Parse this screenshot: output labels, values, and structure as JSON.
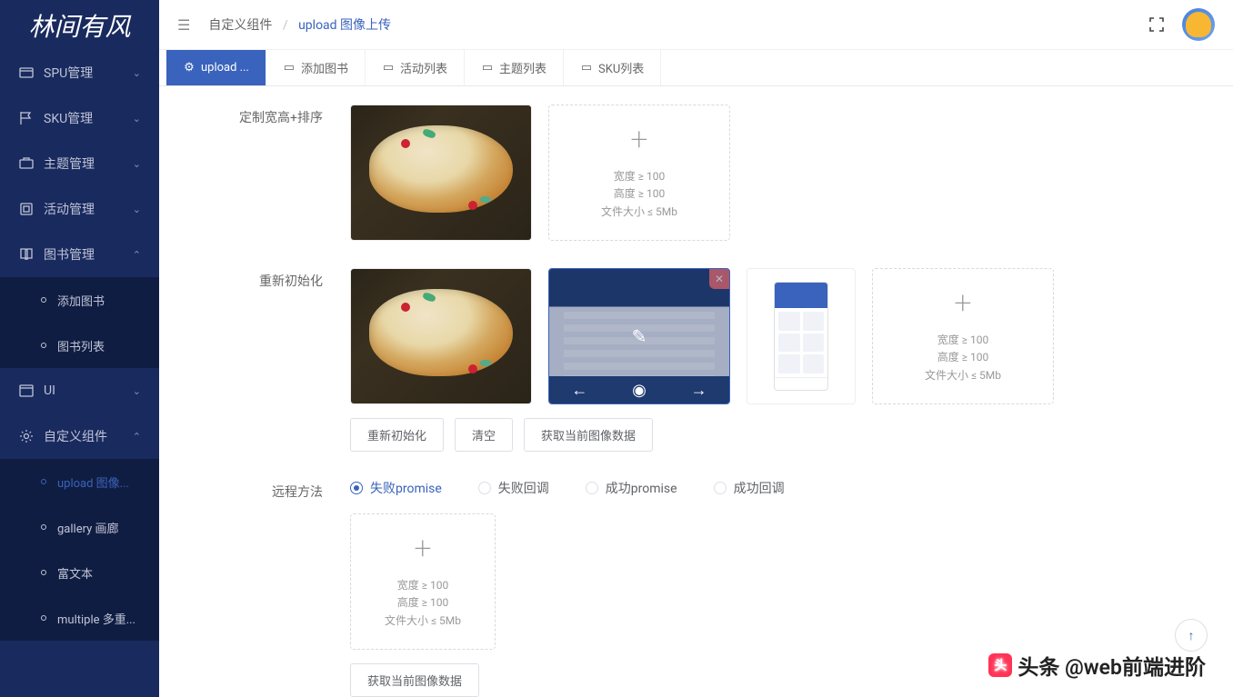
{
  "logo": "林间有风",
  "sidebar": {
    "items": [
      {
        "label": "SPU管理",
        "expanded": false
      },
      {
        "label": "SKU管理",
        "expanded": false
      },
      {
        "label": "主题管理",
        "expanded": false
      },
      {
        "label": "活动管理",
        "expanded": false
      },
      {
        "label": "图书管理",
        "expanded": true,
        "children": [
          {
            "label": "添加图书"
          },
          {
            "label": "图书列表"
          }
        ]
      },
      {
        "label": "UI",
        "expanded": false
      },
      {
        "label": "自定义组件",
        "expanded": true,
        "children": [
          {
            "label": "upload 图像...",
            "active": true
          },
          {
            "label": "gallery 画廊"
          },
          {
            "label": "富文本"
          },
          {
            "label": "multiple 多重..."
          }
        ]
      }
    ]
  },
  "header": {
    "breadcrumb": {
      "root": "自定义组件",
      "current": "upload 图像上传"
    }
  },
  "tabs": [
    {
      "label": "upload ...",
      "active": true
    },
    {
      "label": "添加图书"
    },
    {
      "label": "活动列表"
    },
    {
      "label": "主题列表"
    },
    {
      "label": "SKU列表"
    }
  ],
  "sections": {
    "customSize": {
      "label": "定制宽高+排序",
      "hints": {
        "width": "宽度 ≥ 100",
        "height": "高度 ≥ 100",
        "size": "文件大小 ≤ 5Mb"
      }
    },
    "reinit": {
      "label": "重新初始化",
      "hints": {
        "width": "宽度 ≥ 100",
        "height": "高度 ≥ 100",
        "size": "文件大小 ≤ 5Mb"
      },
      "buttons": {
        "reinit": "重新初始化",
        "clear": "清空",
        "getData": "获取当前图像数据"
      }
    },
    "remote": {
      "label": "远程方法",
      "options": [
        {
          "label": "失败promise",
          "checked": true
        },
        {
          "label": "失败回调",
          "checked": false
        },
        {
          "label": "成功promise",
          "checked": false
        },
        {
          "label": "成功回调",
          "checked": false
        }
      ],
      "hints": {
        "width": "宽度 ≥ 100",
        "height": "高度 ≥ 100",
        "size": "文件大小 ≤ 5Mb"
      },
      "button": "获取当前图像数据"
    }
  },
  "watermark": "头条 @web前端进阶"
}
